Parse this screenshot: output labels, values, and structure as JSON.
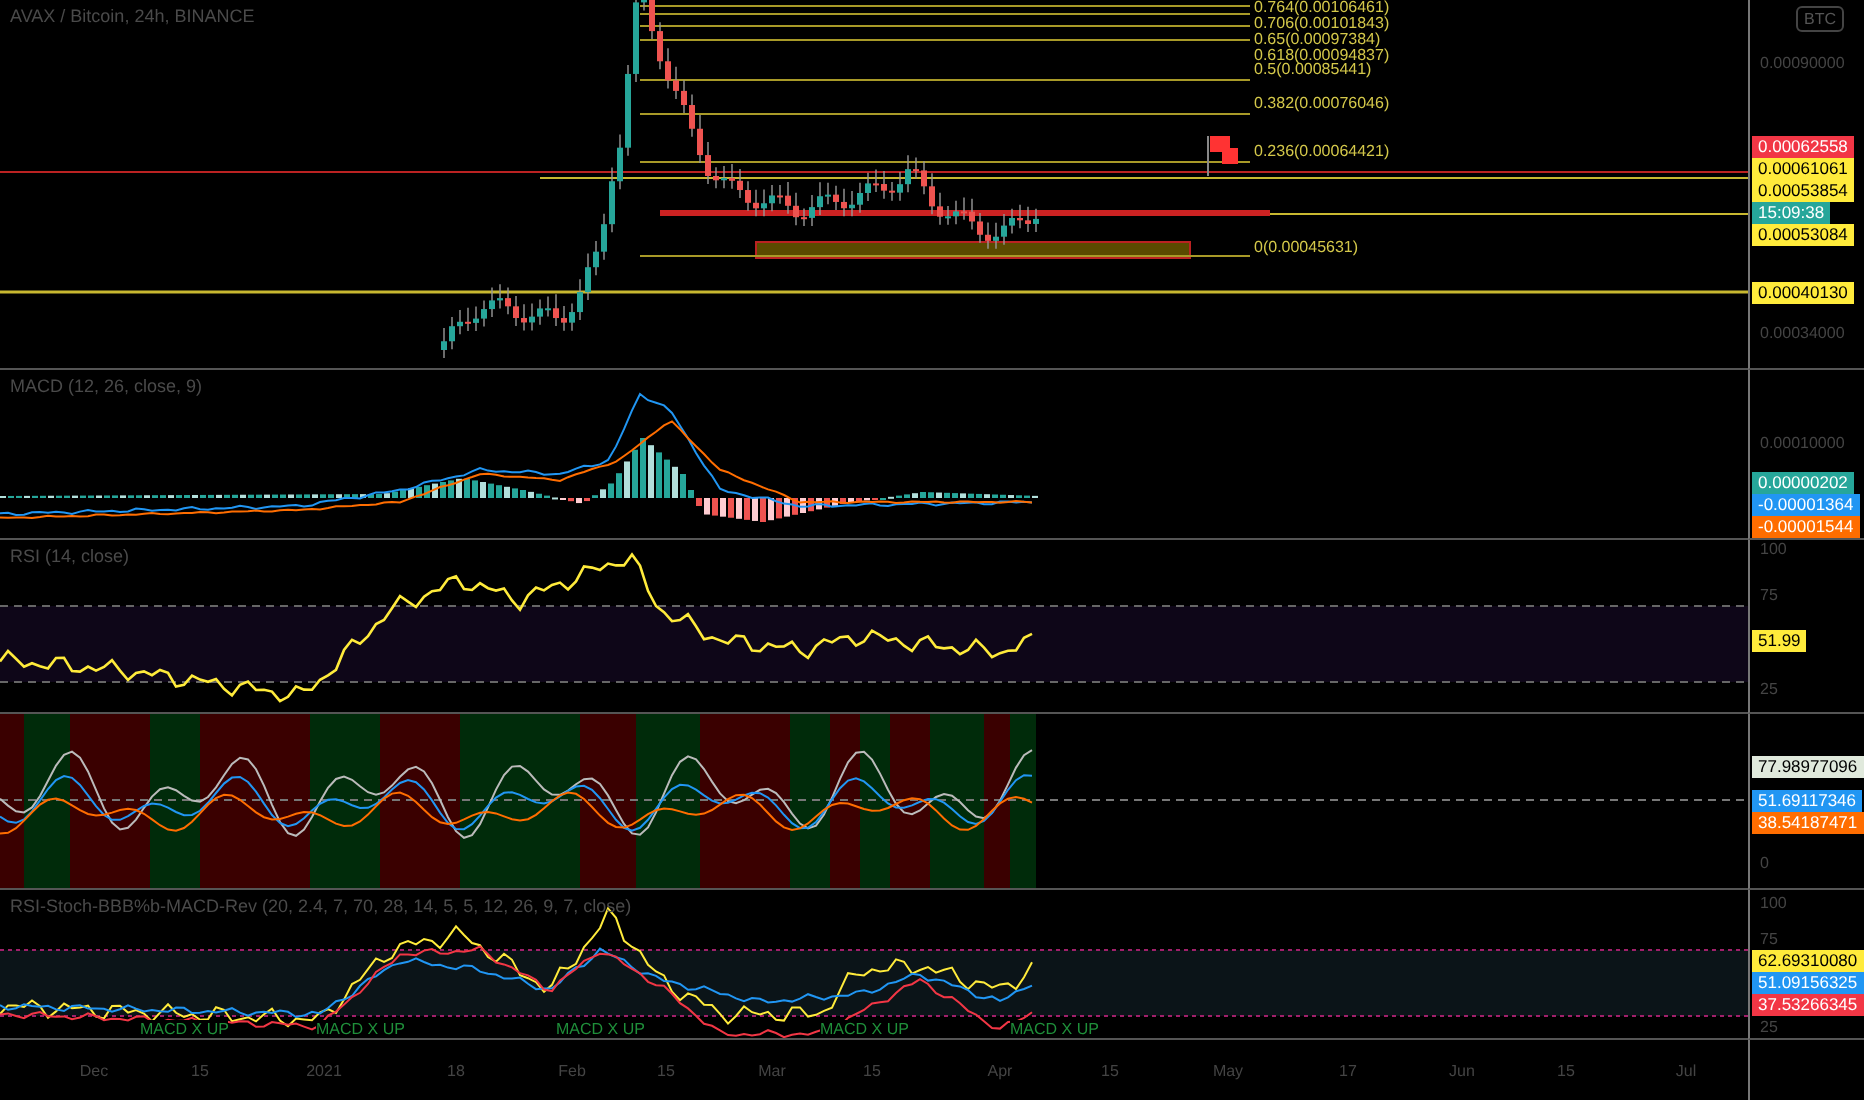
{
  "header": {
    "title": "AVAX / Bitcoin, 24h, BINANCE",
    "currency_badge": "BTC"
  },
  "main_pane": {
    "fib_levels": [
      "0.764(0.00106461)",
      "0.706(0.00101843)",
      "0.65(0.00097384)",
      "0.618(0.00094837)",
      "0.5(0.00085441)",
      "0.382(0.00076046)",
      "0.236(0.00064421)",
      "0(0.00045631)"
    ],
    "axis_ticks": [
      "0.00090000",
      "0.00034000"
    ],
    "price_tags": [
      {
        "text": "0.00062558",
        "color": "#f23645"
      },
      {
        "text": "0.00061061",
        "color": "#ffeb3b"
      },
      {
        "text": "0.00053854",
        "color": "#ffeb3b"
      },
      {
        "text": "15:09:38",
        "color": "#26a69a"
      },
      {
        "text": "0.00053084",
        "color": "#ffeb3b"
      },
      {
        "text": "0.00040130",
        "color": "#ffeb3b"
      }
    ]
  },
  "macd_pane": {
    "title": "MACD (12, 26, close, 9)",
    "axis_ticks": [
      "0.00010000"
    ],
    "value_tags": [
      {
        "text": "0.00000202",
        "color": "#26a69a"
      },
      {
        "text": "-0.00001364",
        "color": "#2196f3"
      },
      {
        "text": "-0.00001544",
        "color": "#ff6d00"
      }
    ]
  },
  "rsi_pane": {
    "title": "RSI (14, close)",
    "axis_ticks": [
      "100",
      "75",
      "25"
    ],
    "value_tags": [
      {
        "text": "51.99",
        "color": "#ffeb3b"
      }
    ]
  },
  "oscillator_pane": {
    "axis_ticks": [
      "0"
    ],
    "value_tags": [
      {
        "text": "77.98977096",
        "color": "#e0e9dc"
      },
      {
        "text": "51.69117346",
        "color": "#2196f3"
      },
      {
        "text": "38.54187471",
        "color": "#ff6d00"
      }
    ]
  },
  "rev_pane": {
    "title": "RSI-Stoch-BBB%b-MACD-Rev (20, 2.4, 7, 70, 28, 14, 5, 5, 12, 26, 9, 7, close)",
    "axis_ticks": [
      "100",
      "75",
      "25"
    ],
    "signals": [
      "MACD X UP",
      "MACD X UP",
      "MACD X UP",
      "MACD X UP",
      "MACD X UP"
    ],
    "value_tags": [
      {
        "text": "62.69310080",
        "color": "#ffeb3b"
      },
      {
        "text": "51.09156325",
        "color": "#2196f3"
      },
      {
        "text": "37.53266345",
        "color": "#f23645"
      }
    ]
  },
  "time_axis": [
    "Dec",
    "15",
    "2021",
    "18",
    "Feb",
    "15",
    "Mar",
    "15",
    "Apr",
    "15",
    "May",
    "17",
    "Jun",
    "15",
    "Jul"
  ]
}
